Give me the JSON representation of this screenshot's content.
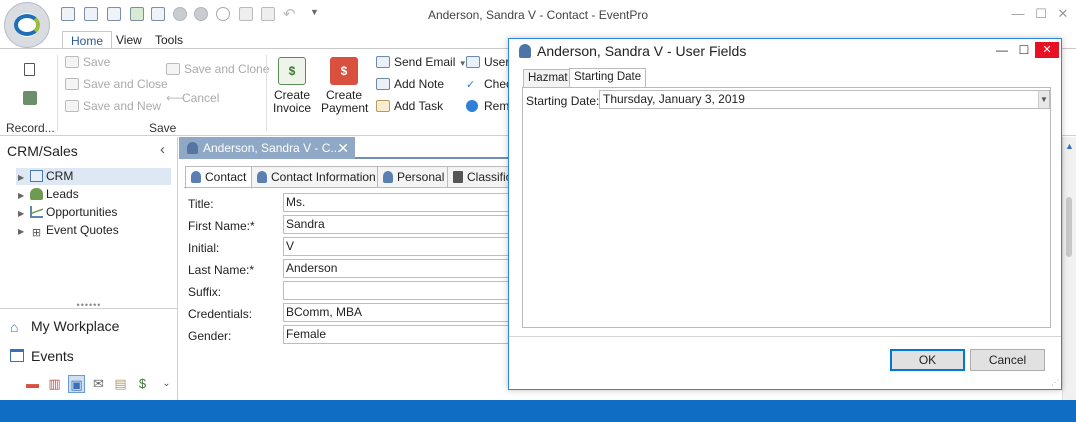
{
  "window": {
    "title": "Anderson, Sandra V - Contact - EventPro",
    "controls": [
      "minimize-icon",
      "maximize-icon",
      "close-icon"
    ]
  },
  "ribbon": {
    "tabs": [
      "Home",
      "View",
      "Tools"
    ],
    "active_tab": "Home",
    "record_group_label": "Record...",
    "save_group": {
      "label": "Save",
      "save": "Save",
      "save_and_close": "Save and Close",
      "save_and_new": "Save and New",
      "save_and_clone": "Save and Clone",
      "cancel": "Cancel"
    },
    "create_invoice": [
      "Create",
      "Invoice"
    ],
    "create_payment": [
      "Create",
      "Payment"
    ],
    "send_email": "Send Email",
    "add_note": "Add Note",
    "add_task": "Add Task",
    "user_partial": "User",
    "check_partial": "Chec",
    "rem_partial": "Rem"
  },
  "nav": {
    "title": "CRM/Sales",
    "tree": [
      {
        "label": "CRM",
        "icon": "contact-card-icon",
        "selected": true
      },
      {
        "label": "Leads",
        "icon": "person-icon",
        "selected": false
      },
      {
        "label": "Opportunities",
        "icon": "chart-icon",
        "selected": false
      },
      {
        "label": "Event Quotes",
        "icon": "cart-icon",
        "selected": false
      }
    ],
    "workplace": "My Workplace",
    "events": "Events"
  },
  "document_tab": {
    "label": "Anderson, Sandra V - C..."
  },
  "form": {
    "tabs": [
      "Contact",
      "Contact Information",
      "Personal",
      "Classific"
    ],
    "active_tab": "Contact",
    "fields": [
      {
        "label": "Title:",
        "value": "Ms."
      },
      {
        "label": "First Name:*",
        "value": "Sandra"
      },
      {
        "label": "Initial:",
        "value": "V"
      },
      {
        "label": "Last Name:*",
        "value": "Anderson"
      },
      {
        "label": "Suffix:",
        "value": ""
      },
      {
        "label": "Credentials:",
        "value": "BComm, MBA"
      },
      {
        "label": "Gender:",
        "value": "Female"
      }
    ]
  },
  "dialog": {
    "title": "Anderson, Sandra V - User Fields",
    "tabs": [
      "Hazmat",
      "Starting Date"
    ],
    "active_tab": "Starting Date",
    "field_label": "Starting Date:",
    "field_value": "Thursday, January 3, 2019",
    "ok": "OK",
    "cancel": "Cancel"
  },
  "colors": {
    "accent": "#0f6dc4",
    "dialog_border": "#2b8ae0",
    "doc_tab": "#8fa8c5",
    "close_red": "#e81123"
  }
}
